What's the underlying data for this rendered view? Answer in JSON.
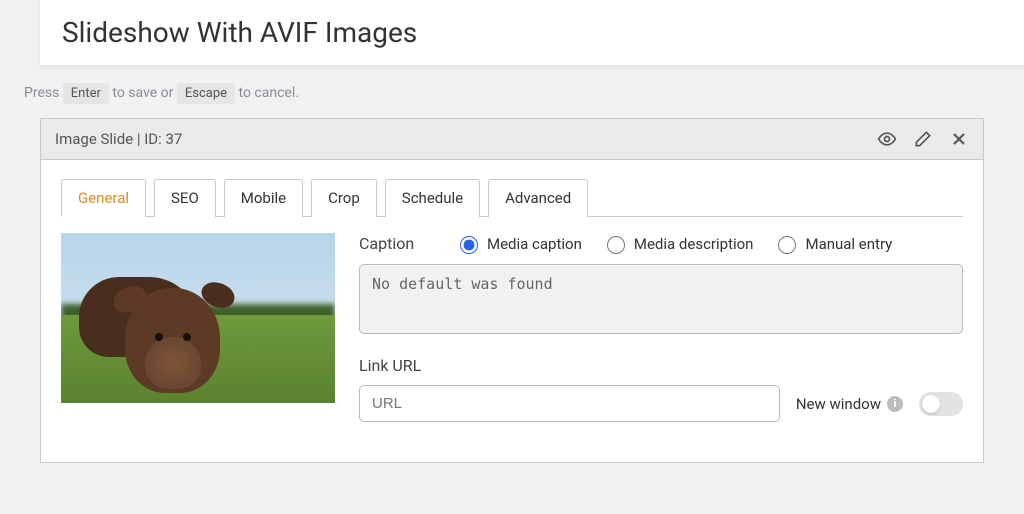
{
  "title": "Slideshow With AVIF Images",
  "hint": {
    "press": "Press ",
    "enter": "Enter",
    "toSave": " to save or ",
    "escape": "Escape",
    "toCancel": " to cancel."
  },
  "panel": {
    "header": "Image Slide | ID: 37"
  },
  "tabs": [
    {
      "label": "General",
      "active": true
    },
    {
      "label": "SEO"
    },
    {
      "label": "Mobile"
    },
    {
      "label": "Crop"
    },
    {
      "label": "Schedule"
    },
    {
      "label": "Advanced"
    }
  ],
  "caption": {
    "label": "Caption",
    "options": [
      "Media caption",
      "Media description",
      "Manual entry"
    ],
    "selected": 0,
    "value": "No default was found"
  },
  "link": {
    "label": "Link URL",
    "placeholder": "URL",
    "newWindowLabel": "New window",
    "newWindowOn": false
  }
}
